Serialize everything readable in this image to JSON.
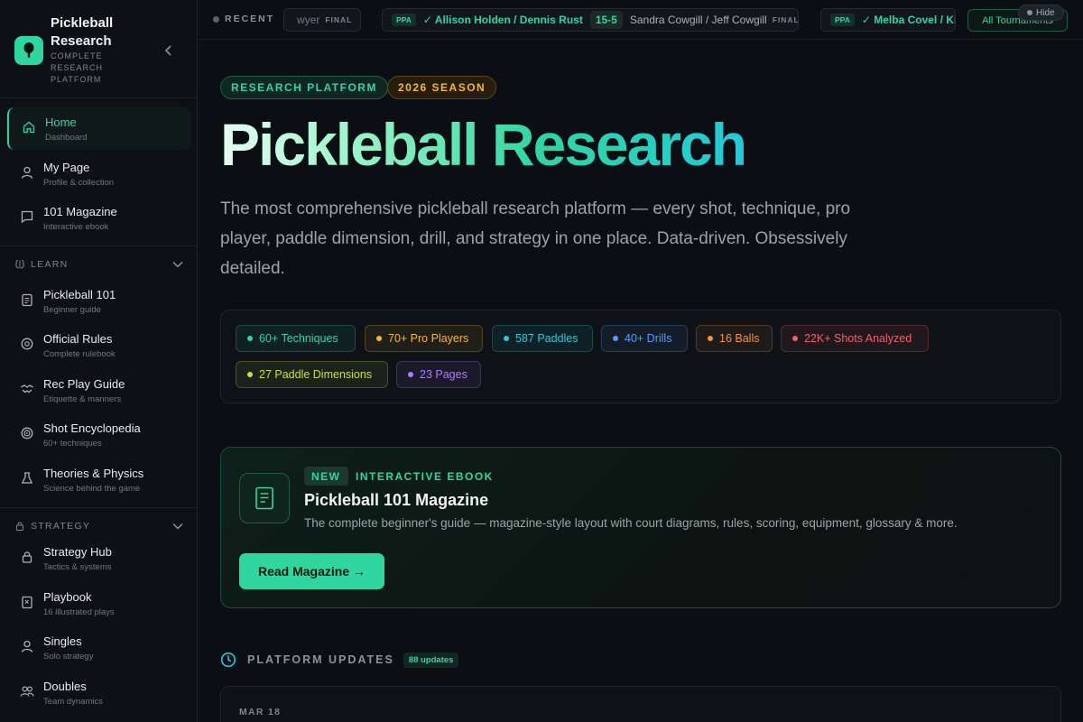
{
  "brand": {
    "title": "Pickleball Research",
    "subtitle": "COMPLETE RESEARCH PLATFORM"
  },
  "nav": {
    "top": [
      {
        "label": "Home",
        "sub": "Dashboard",
        "icon": "home-icon",
        "active": true
      },
      {
        "label": "My Page",
        "sub": "Profile & collection",
        "icon": "user-icon"
      },
      {
        "label": "101 Magazine",
        "sub": "Interactive ebook",
        "icon": "book-open-icon"
      }
    ],
    "learn": {
      "label": "LEARN",
      "items": [
        {
          "label": "Pickleball 101",
          "sub": "Beginner guide",
          "icon": "clipboard-icon"
        },
        {
          "label": "Official Rules",
          "sub": "Complete rulebook",
          "icon": "rules-icon"
        },
        {
          "label": "Rec Play Guide",
          "sub": "Etiquette & manners",
          "icon": "handshake-icon"
        },
        {
          "label": "Shot Encyclopedia",
          "sub": "60+ techniques",
          "icon": "target-icon"
        },
        {
          "label": "Theories & Physics",
          "sub": "Science behind the game",
          "icon": "flask-icon"
        }
      ]
    },
    "strategy": {
      "label": "STRATEGY",
      "items": [
        {
          "label": "Strategy Hub",
          "sub": "Tactics & systems",
          "icon": "lock-icon"
        },
        {
          "label": "Playbook",
          "sub": "16 illustrated plays",
          "icon": "playbook-icon"
        },
        {
          "label": "Singles",
          "sub": "Solo strategy",
          "icon": "user-icon"
        },
        {
          "label": "Doubles",
          "sub": "Team dynamics",
          "icon": "users-icon"
        }
      ]
    }
  },
  "ticker": {
    "recent_label": "RECENT",
    "partial_left": {
      "name": "wyer",
      "status": "FINAL"
    },
    "match1": {
      "tour": "PPA",
      "winner": "✓ Allison Holden / Dennis Rust",
      "score": "15-5",
      "loser": "Sandra Cowgill / Jeff Cowgill",
      "status": "FINAL"
    },
    "match2": {
      "tour": "PPA",
      "winner": "✓ Melba Covel / Ki"
    },
    "all_button": "All Tournaments",
    "hide_label": "Hide"
  },
  "hero": {
    "pill_platform": "RESEARCH PLATFORM",
    "pill_season": "2026 SEASON",
    "title": "Pickleball Research",
    "description": "The most comprehensive pickleball research platform — every shot, technique, pro player, paddle dimension, drill, and strategy in one place. Data-driven. Obsessively detailed."
  },
  "stats": [
    {
      "label": "60+ Techniques",
      "color": "#2fd6a0"
    },
    {
      "label": "70+ Pro Players",
      "color": "#f5b731"
    },
    {
      "label": "587 Paddles",
      "color": "#25c8d8"
    },
    {
      "label": "40+ Drills",
      "color": "#5b9cf5"
    },
    {
      "label": "16 Balls",
      "color": "#f5923a"
    },
    {
      "label": "22K+ Shots Analyzed",
      "color": "#f0606a"
    },
    {
      "label": "27 Paddle Dimensions",
      "color": "#c4e33a"
    },
    {
      "label": "23 Pages",
      "color": "#b07cf5"
    }
  ],
  "ebook": {
    "tag": "NEW",
    "kind": "INTERACTIVE EBOOK",
    "title": "Pickleball 101 Magazine",
    "description": "The complete beginner's guide — magazine-style layout with court diagrams, rules, scoring, equipment, glossary & more.",
    "button": "Read Magazine →"
  },
  "updates": {
    "label": "PLATFORM UPDATES",
    "count": "88 updates",
    "first_date": "MAR 18"
  }
}
